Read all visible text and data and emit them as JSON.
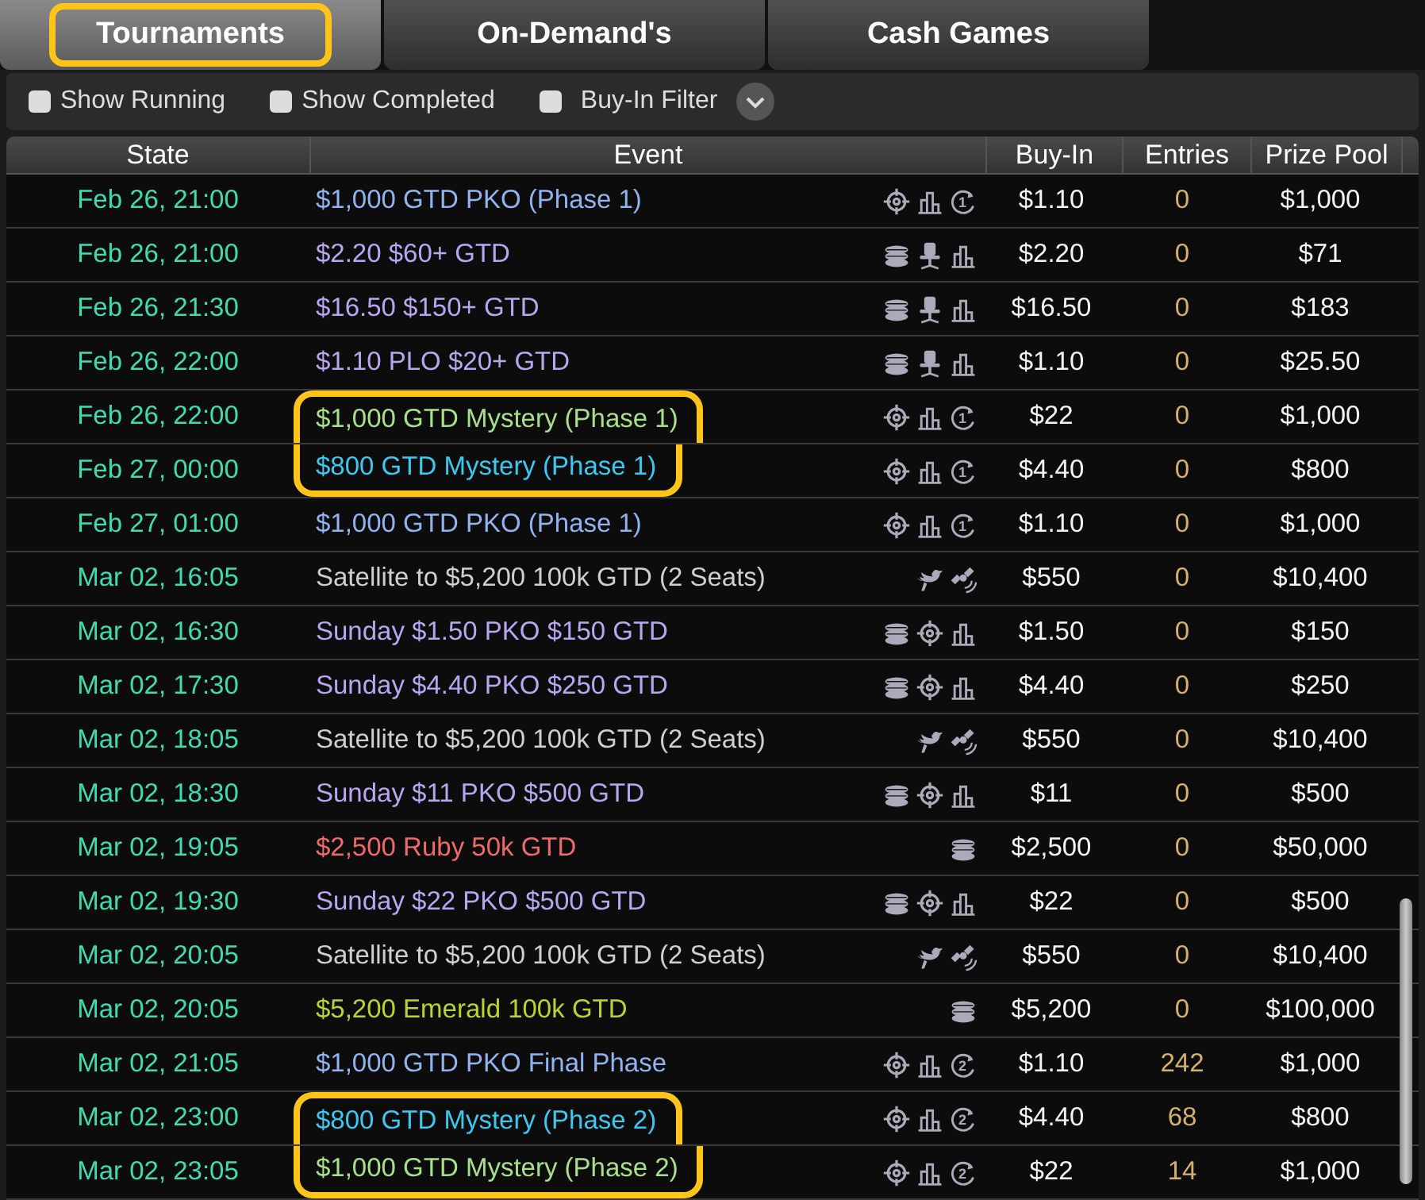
{
  "tabs": [
    {
      "label": "Tournaments",
      "selected": true,
      "highlighted": true
    },
    {
      "label": "On-Demand's",
      "selected": false,
      "highlighted": false
    },
    {
      "label": "Cash Games",
      "selected": false,
      "highlighted": false
    }
  ],
  "filters": [
    {
      "label": "Show Running",
      "checked": false
    },
    {
      "label": "Show Completed",
      "checked": false
    },
    {
      "label": "Buy-In Filter",
      "checked": false,
      "dropdown": true
    }
  ],
  "table": {
    "columns": [
      "State",
      "Event",
      "Buy-In",
      "Entries",
      "Prize Pool"
    ],
    "rows": [
      {
        "state": "Feb 26, 21:00",
        "event": "$1,000 GTD PKO (Phase 1)",
        "color": "#8fb4f0",
        "highlighted": false,
        "icons": [
          {
            "kind": "target"
          },
          {
            "kind": "chart"
          },
          {
            "kind": "reentry",
            "label": "1"
          }
        ],
        "buy_in": "$1.10",
        "entries": "0",
        "prize_pool": "$1,000"
      },
      {
        "state": "Feb 26, 21:00",
        "event": "$2.20 $60+ GTD",
        "color": "#b9a6f0",
        "highlighted": false,
        "icons": [
          {
            "kind": "stack"
          },
          {
            "kind": "seat"
          },
          {
            "kind": "chart"
          }
        ],
        "buy_in": "$2.20",
        "entries": "0",
        "prize_pool": "$71"
      },
      {
        "state": "Feb 26, 21:30",
        "event": "$16.50 $150+ GTD",
        "color": "#b9a6f0",
        "highlighted": false,
        "icons": [
          {
            "kind": "stack"
          },
          {
            "kind": "seat"
          },
          {
            "kind": "chart"
          }
        ],
        "buy_in": "$16.50",
        "entries": "0",
        "prize_pool": "$183"
      },
      {
        "state": "Feb 26, 22:00",
        "event": "$1.10 PLO $20+ GTD",
        "color": "#b9a6f0",
        "highlighted": false,
        "icons": [
          {
            "kind": "stack"
          },
          {
            "kind": "seat"
          },
          {
            "kind": "chart"
          }
        ],
        "buy_in": "$1.10",
        "entries": "0",
        "prize_pool": "$25.50"
      },
      {
        "state": "Feb 26, 22:00",
        "event": "$1,000 GTD Mystery (Phase 1)",
        "color": "#a8e08a",
        "highlighted": true,
        "icons": [
          {
            "kind": "target"
          },
          {
            "kind": "chart"
          },
          {
            "kind": "reentry",
            "label": "1"
          }
        ],
        "buy_in": "$22",
        "entries": "0",
        "prize_pool": "$1,000"
      },
      {
        "state": "Feb 27, 00:00",
        "event": "$800 GTD Mystery (Phase 1)",
        "color": "#3cc8f0",
        "highlighted": true,
        "icons": [
          {
            "kind": "target"
          },
          {
            "kind": "chart"
          },
          {
            "kind": "reentry",
            "label": "1"
          }
        ],
        "buy_in": "$4.40",
        "entries": "0",
        "prize_pool": "$800"
      },
      {
        "state": "Feb 27, 01:00",
        "event": "$1,000 GTD PKO (Phase 1)",
        "color": "#8fb4f0",
        "highlighted": false,
        "icons": [
          {
            "kind": "target"
          },
          {
            "kind": "chart"
          },
          {
            "kind": "reentry",
            "label": "1"
          }
        ],
        "buy_in": "$1.10",
        "entries": "0",
        "prize_pool": "$1,000"
      },
      {
        "state": "Mar 02, 16:05",
        "event": "Satellite to $5,200 100k GTD (2 Seats)",
        "color": "#cfcfcf",
        "highlighted": false,
        "icons": [
          {
            "kind": "bird"
          },
          {
            "kind": "satellite"
          }
        ],
        "buy_in": "$550",
        "entries": "0",
        "prize_pool": "$10,400"
      },
      {
        "state": "Mar 02, 16:30",
        "event": "Sunday $1.50 PKO $150 GTD",
        "color": "#b9a6f0",
        "highlighted": false,
        "icons": [
          {
            "kind": "stack"
          },
          {
            "kind": "target"
          },
          {
            "kind": "chart"
          }
        ],
        "buy_in": "$1.50",
        "entries": "0",
        "prize_pool": "$150"
      },
      {
        "state": "Mar 02, 17:30",
        "event": "Sunday $4.40 PKO $250 GTD",
        "color": "#b9a6f0",
        "highlighted": false,
        "icons": [
          {
            "kind": "stack"
          },
          {
            "kind": "target"
          },
          {
            "kind": "chart"
          }
        ],
        "buy_in": "$4.40",
        "entries": "0",
        "prize_pool": "$250"
      },
      {
        "state": "Mar 02, 18:05",
        "event": "Satellite to $5,200 100k GTD (2 Seats)",
        "color": "#cfcfcf",
        "highlighted": false,
        "icons": [
          {
            "kind": "bird"
          },
          {
            "kind": "satellite"
          }
        ],
        "buy_in": "$550",
        "entries": "0",
        "prize_pool": "$10,400"
      },
      {
        "state": "Mar 02, 18:30",
        "event": "Sunday $11 PKO $500 GTD",
        "color": "#b9a6f0",
        "highlighted": false,
        "icons": [
          {
            "kind": "stack"
          },
          {
            "kind": "target"
          },
          {
            "kind": "chart"
          }
        ],
        "buy_in": "$11",
        "entries": "0",
        "prize_pool": "$500"
      },
      {
        "state": "Mar 02, 19:05",
        "event": "$2,500 Ruby 50k GTD",
        "color": "#f06a6a",
        "highlighted": false,
        "icons": [
          {
            "kind": "stack"
          }
        ],
        "buy_in": "$2,500",
        "entries": "0",
        "prize_pool": "$50,000"
      },
      {
        "state": "Mar 02, 19:30",
        "event": "Sunday $22 PKO $500 GTD",
        "color": "#b9a6f0",
        "highlighted": false,
        "icons": [
          {
            "kind": "stack"
          },
          {
            "kind": "target"
          },
          {
            "kind": "chart"
          }
        ],
        "buy_in": "$22",
        "entries": "0",
        "prize_pool": "$500"
      },
      {
        "state": "Mar 02, 20:05",
        "event": "Satellite to $5,200 100k GTD (2 Seats)",
        "color": "#cfcfcf",
        "highlighted": false,
        "icons": [
          {
            "kind": "bird"
          },
          {
            "kind": "satellite"
          }
        ],
        "buy_in": "$550",
        "entries": "0",
        "prize_pool": "$10,400"
      },
      {
        "state": "Mar 02, 20:05",
        "event": "$5,200 Emerald 100k GTD",
        "color": "#b8d430",
        "highlighted": false,
        "icons": [
          {
            "kind": "stack"
          }
        ],
        "buy_in": "$5,200",
        "entries": "0",
        "prize_pool": "$100,000"
      },
      {
        "state": "Mar 02, 21:05",
        "event": "$1,000 GTD PKO Final Phase",
        "color": "#8fb4f0",
        "highlighted": false,
        "icons": [
          {
            "kind": "target"
          },
          {
            "kind": "chart"
          },
          {
            "kind": "reentry",
            "label": "2"
          }
        ],
        "buy_in": "$1.10",
        "entries": "242",
        "prize_pool": "$1,000"
      },
      {
        "state": "Mar 02, 23:00",
        "event": "$800 GTD Mystery (Phase 2)",
        "color": "#3cc8f0",
        "highlighted": true,
        "icons": [
          {
            "kind": "target"
          },
          {
            "kind": "chart"
          },
          {
            "kind": "reentry",
            "label": "2"
          }
        ],
        "buy_in": "$4.40",
        "entries": "68",
        "prize_pool": "$800"
      },
      {
        "state": "Mar 02, 23:05",
        "event": "$1,000 GTD Mystery (Phase 2)",
        "color": "#a8e08a",
        "highlighted": true,
        "icons": [
          {
            "kind": "target"
          },
          {
            "kind": "chart"
          },
          {
            "kind": "reentry",
            "label": "2"
          }
        ],
        "buy_in": "$22",
        "entries": "14",
        "prize_pool": "$1,000"
      }
    ]
  }
}
